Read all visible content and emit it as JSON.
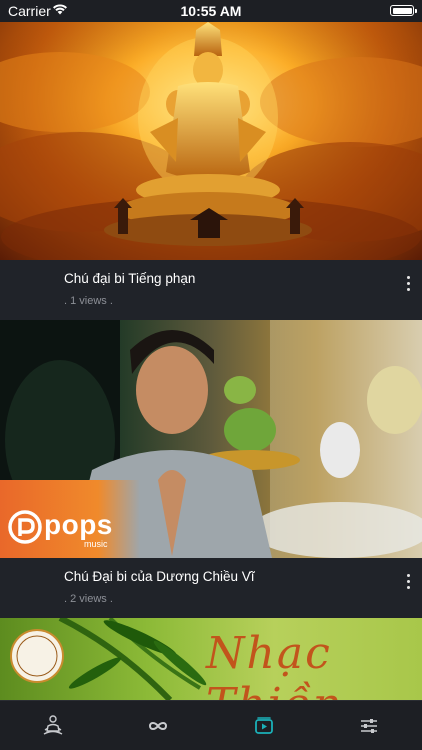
{
  "status_bar": {
    "carrier": "Carrier",
    "time": "10:55 AM"
  },
  "videos": [
    {
      "title": "Chú đại bi Tiếng phạn",
      "views": ". 1 views ."
    },
    {
      "title": "Chú Đại bi của Dương Chiều Vĩ",
      "views": ". 2 views ."
    },
    {
      "title": "",
      "views": ""
    }
  ],
  "thumbnails": {
    "second_logo": {
      "brand": "pops",
      "sub": "music"
    },
    "third_text": "Nhạc Thiền"
  },
  "tab_bar": {
    "tabs": [
      {
        "name": "meditation-icon",
        "active": false
      },
      {
        "name": "infinity-icon",
        "active": false
      },
      {
        "name": "play-video-icon",
        "active": true
      },
      {
        "name": "settings-sliders-icon",
        "active": false
      }
    ],
    "active_color": "#1bb0b8",
    "inactive_color": "#c9cbcf"
  }
}
